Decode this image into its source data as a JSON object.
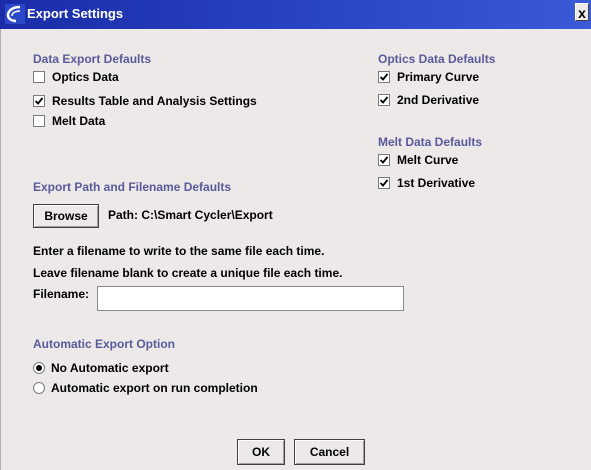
{
  "window": {
    "title": "Export Settings",
    "close_label": "x"
  },
  "data_export": {
    "heading": "Data Export Defaults",
    "items": [
      {
        "label": "Optics Data",
        "checked": false
      },
      {
        "label": "Results Table and Analysis Settings",
        "checked": true
      },
      {
        "label": "Melt Data",
        "checked": false
      }
    ]
  },
  "optics_defaults": {
    "heading": "Optics Data Defaults",
    "items": [
      {
        "label": "Primary Curve",
        "checked": true
      },
      {
        "label": "2nd Derivative",
        "checked": true
      }
    ]
  },
  "melt_defaults": {
    "heading": "Melt Data Defaults",
    "items": [
      {
        "label": "Melt Curve",
        "checked": true
      },
      {
        "label": "1st Derivative",
        "checked": true
      }
    ]
  },
  "export_path": {
    "heading": "Export Path and Filename Defaults",
    "browse_label": "Browse",
    "path_text": "Path: C:\\Smart Cycler\\Export",
    "instruction1": "Enter a filename to write to the same file each time.",
    "instruction2": "Leave filename blank to create a unique file each time.",
    "filename_label": "Filename:",
    "filename_value": ""
  },
  "auto_export": {
    "heading": "Automatic Export Option",
    "options": [
      {
        "label": "No Automatic export",
        "selected": true
      },
      {
        "label": "Automatic export on run completion",
        "selected": false
      }
    ]
  },
  "buttons": {
    "ok_label": "OK",
    "cancel_label": "Cancel"
  },
  "colors": {
    "titlebar": "#2a48c8",
    "heading": "#5a5a9a",
    "background": "#ece9e8"
  }
}
